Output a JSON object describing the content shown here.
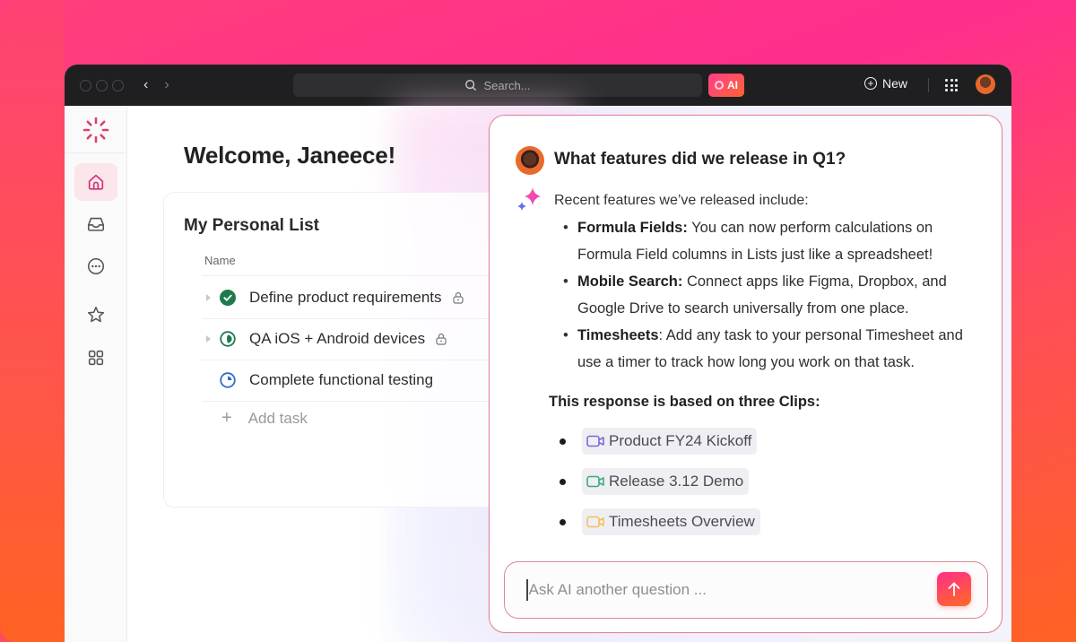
{
  "titlebar": {
    "search_placeholder": "Search...",
    "ai_label": "AI",
    "new_label": "New"
  },
  "sidebar": {
    "items": [
      {
        "name": "home",
        "icon": "home-icon",
        "active": true
      },
      {
        "name": "inbox",
        "icon": "inbox-icon",
        "active": false
      },
      {
        "name": "chat",
        "icon": "more-icon",
        "active": false
      },
      {
        "name": "favorites",
        "icon": "star-icon",
        "active": false
      },
      {
        "name": "spaces",
        "icon": "apps-grid-icon",
        "active": false
      }
    ]
  },
  "main": {
    "welcome": "Welcome, Janeece!",
    "list": {
      "title": "My Personal List",
      "column_header": "Name",
      "tasks": [
        {
          "name": "Define product requirements",
          "status": "complete",
          "locked": true,
          "expandable": true
        },
        {
          "name": "QA iOS + Android devices",
          "status": "in-progress",
          "locked": true,
          "expandable": true
        },
        {
          "name": "Complete functional testing",
          "status": "started",
          "locked": false,
          "expandable": false
        }
      ],
      "add_task_label": "Add task"
    }
  },
  "ai_panel": {
    "question": "What features did we release in Q1?",
    "intro": "Recent features we’ve released include:",
    "features": [
      {
        "title": "Formula Fields:",
        "text": " You can now perform calculations on Formula Field columns in Lists just like a spreadsheet!"
      },
      {
        "title": "Mobile Search:",
        "text": " Connect apps like Figma, Dropbox, and Google Drive to search universally from one place."
      },
      {
        "title": "Timesheets",
        "text": ": Add any task to your personal Timesheet and use a timer to track how long you work on that task."
      }
    ],
    "clips_heading": "This response is based on three Clips:",
    "clips": [
      {
        "label": "Product FY24 Kickoff",
        "color": "#7b6ad6"
      },
      {
        "label": "Release 3.12 Demo",
        "color": "#3eab7c"
      },
      {
        "label": "Timesheets Overview",
        "color": "#f2c058"
      }
    ],
    "ask_placeholder": "Ask AI another question ..."
  }
}
